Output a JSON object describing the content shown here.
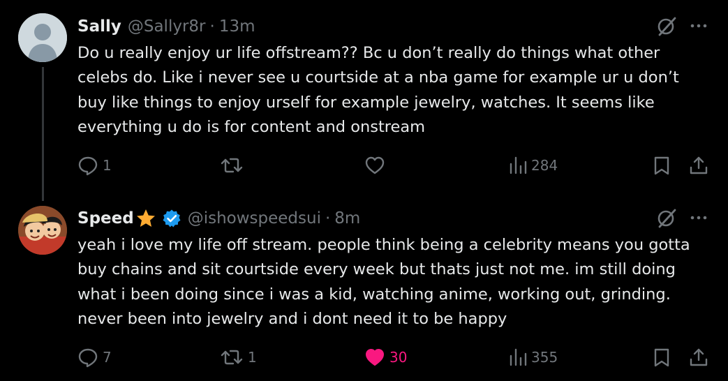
{
  "tweets": [
    {
      "name": "Sally",
      "handle": "@Sallyr8r",
      "time": "13m",
      "text": "Do u really enjoy ur life offstream?? Bc u don’t really do things what other celebs do. Like i never see u courtside at a nba game for example ur u don’t buy like things to enjoy urself for example jewelry, watches. It seems like everything u do is for content and onstream",
      "replies": "1",
      "retweets": "",
      "likes": "",
      "views": "284",
      "liked": false
    },
    {
      "name": "Speed",
      "handle": "@ishowspeedsui",
      "time": "8m",
      "text": "yeah i love my life off stream. people think being a celebrity means you gotta buy chains and sit courtside every week but thats just not me. im still doing what i been doing since i was a kid, watching anime, working out, grinding. never been into jewelry and i dont need it to be happy",
      "replies": "7",
      "retweets": "1",
      "likes": "30",
      "views": "355",
      "liked": true,
      "verified": true
    }
  ],
  "separator": "·",
  "colors": {
    "background": "#000000",
    "text": "#e7e9ea",
    "muted": "#71767b",
    "like": "#f91880",
    "verified": "#1d9bf0",
    "star": "#ffac33"
  },
  "icons": [
    "grok-icon",
    "more-icon",
    "reply-icon",
    "retweet-icon",
    "like-icon",
    "views-icon",
    "bookmark-icon",
    "share-icon",
    "star-icon",
    "verified-badge-icon"
  ]
}
